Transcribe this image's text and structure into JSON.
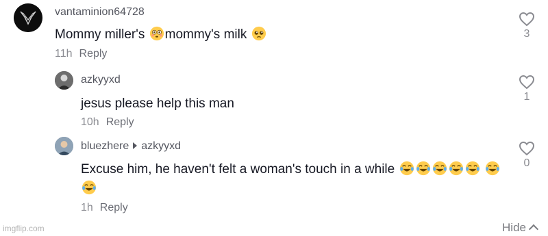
{
  "comments": [
    {
      "username": "vantaminion64728",
      "text_parts": [
        "Mommy miller's ",
        "mommy's milk "
      ],
      "emojis": [
        "flushed-face",
        "pleading-face"
      ],
      "time": "11h",
      "reply_label": "Reply",
      "likes": "3"
    },
    {
      "username": "azkyyxd",
      "text": "jesus please help this man",
      "time": "10h",
      "reply_label": "Reply",
      "likes": "1"
    },
    {
      "username": "bluezhere",
      "reply_to": "azkyyxd",
      "text": "Excuse him, he haven't felt a woman's touch in a while ",
      "emojis": [
        "face-with-tears-of-joy"
      ],
      "time": "1h",
      "reply_label": "Reply",
      "likes": "0"
    }
  ],
  "footer": {
    "hide_label": "Hide",
    "watermark": "imgflip.com"
  }
}
